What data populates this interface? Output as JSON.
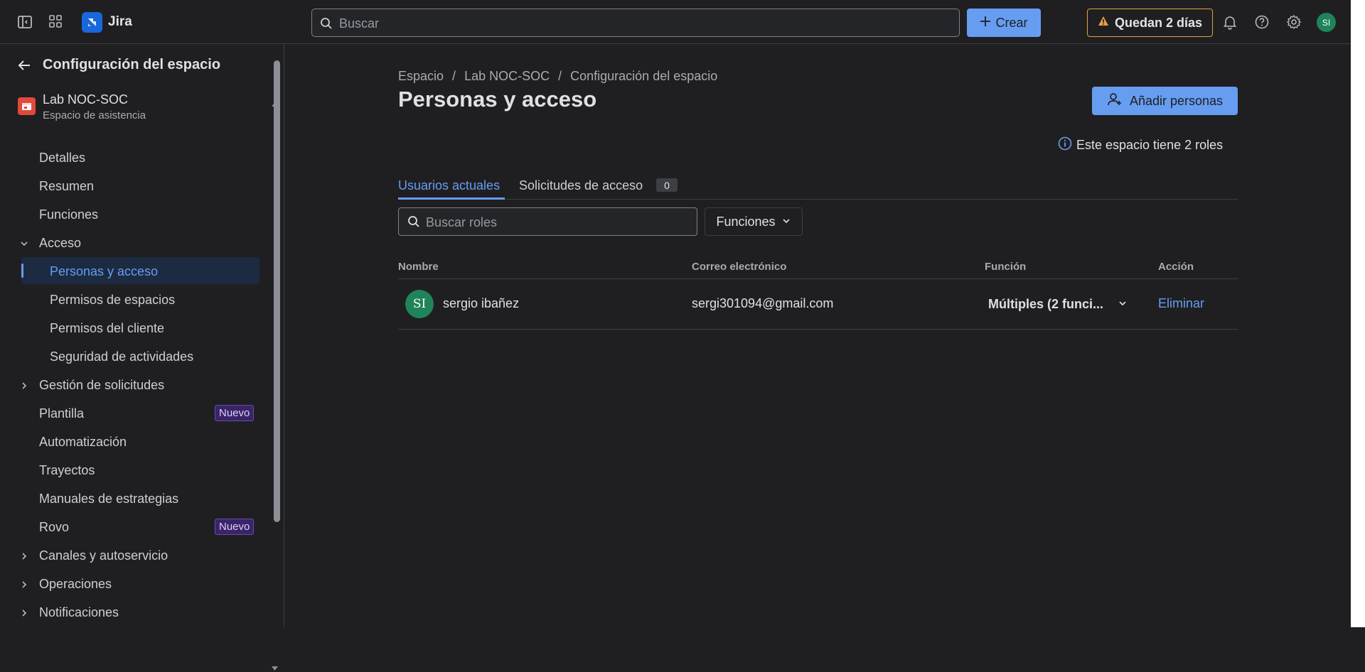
{
  "topbar": {
    "app_name": "Jira",
    "search_placeholder": "Buscar",
    "create_label": "Crear",
    "trial_label": "Quedan 2 días",
    "avatar_initials": "SI"
  },
  "sidebar": {
    "title": "Configuración del espacio",
    "project_name": "Lab NOC-SOC",
    "project_type": "Espacio de asistencia",
    "items": [
      {
        "label": "Detalles"
      },
      {
        "label": "Resumen"
      },
      {
        "label": "Funciones"
      },
      {
        "label": "Acceso",
        "expanded": true
      },
      {
        "label": "Personas y acceso",
        "active": true
      },
      {
        "label": "Permisos de espacios"
      },
      {
        "label": "Permisos del cliente"
      },
      {
        "label": "Seguridad de actividades"
      },
      {
        "label": "Gestión de solicitudes"
      },
      {
        "label": "Plantilla",
        "badge": "Nuevo"
      },
      {
        "label": "Automatización"
      },
      {
        "label": "Trayectos"
      },
      {
        "label": "Manuales de estrategias"
      },
      {
        "label": "Rovo",
        "badge": "Nuevo"
      },
      {
        "label": "Canales y autoservicio"
      },
      {
        "label": "Operaciones"
      },
      {
        "label": "Notificaciones"
      }
    ]
  },
  "main": {
    "breadcrumb": [
      "Espacio",
      "/",
      "Lab NOC-SOC",
      "/",
      "Configuración del espacio"
    ],
    "title": "Personas y acceso",
    "add_people_label": "Añadir personas",
    "roles_info": "Este espacio tiene 2 roles",
    "tabs": [
      {
        "label": "Usuarios actuales",
        "active": true
      },
      {
        "label": "Solicitudes de acceso",
        "count": "0"
      }
    ],
    "role_search_placeholder": "Buscar roles",
    "functions_filter": "Funciones",
    "table": {
      "headers": [
        "Nombre",
        "Correo electrónico",
        "Función",
        "Acción"
      ],
      "rows": [
        {
          "initials": "SI",
          "name": "sergio ibañez",
          "email": "sergi301094@gmail.com",
          "function": "Múltiples (2 funci...",
          "action": "Eliminar"
        }
      ]
    }
  },
  "colors": {
    "accent": "#669df1",
    "avatar": "#1f845a",
    "badge_new": "#3b2466",
    "warning": "#e2a03f"
  }
}
